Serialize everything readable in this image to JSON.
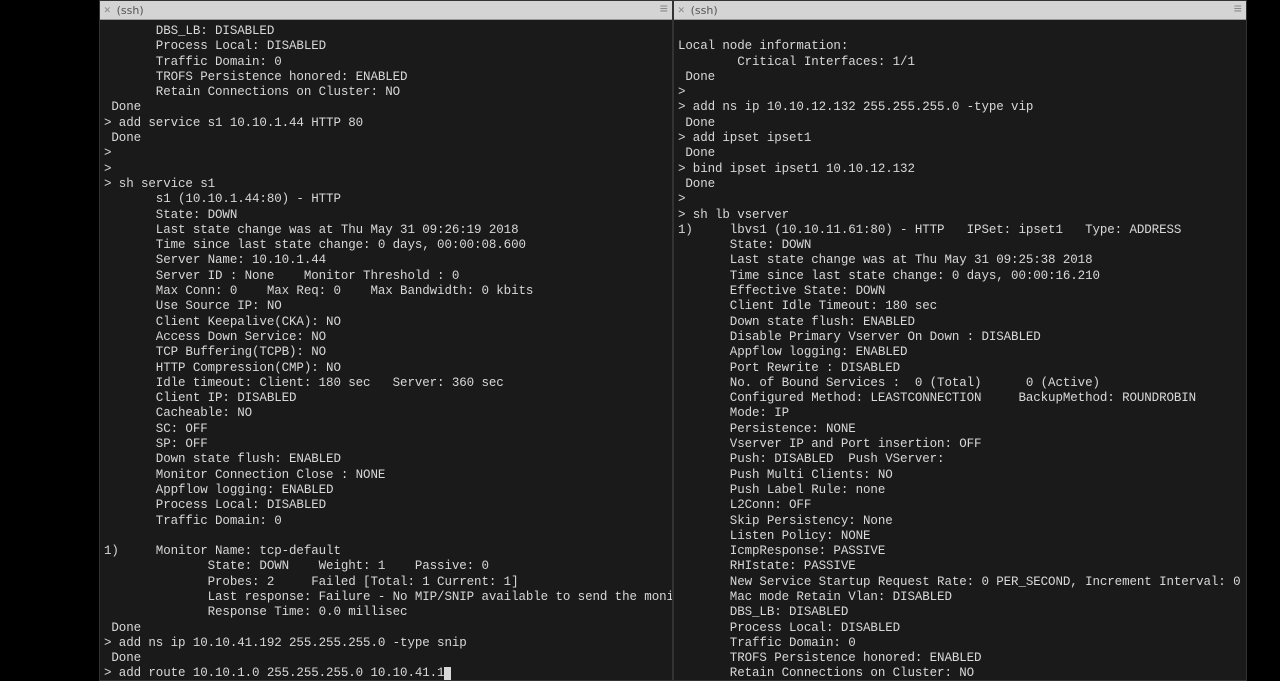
{
  "tabs": {
    "left": {
      "title": "(ssh)"
    },
    "right": {
      "title": "(ssh)"
    }
  },
  "left_terminal": [
    "       DBS_LB: DISABLED",
    "       Process Local: DISABLED",
    "       Traffic Domain: 0",
    "       TROFS Persistence honored: ENABLED",
    "       Retain Connections on Cluster: NO",
    " Done",
    "> add service s1 10.10.1.44 HTTP 80",
    " Done",
    ">",
    ">",
    "> sh service s1",
    "       s1 (10.10.1.44:80) - HTTP",
    "       State: DOWN",
    "       Last state change was at Thu May 31 09:26:19 2018",
    "       Time since last state change: 0 days, 00:00:08.600",
    "       Server Name: 10.10.1.44",
    "       Server ID : None    Monitor Threshold : 0",
    "       Max Conn: 0    Max Req: 0    Max Bandwidth: 0 kbits",
    "       Use Source IP: NO",
    "       Client Keepalive(CKA): NO",
    "       Access Down Service: NO",
    "       TCP Buffering(TCPB): NO",
    "       HTTP Compression(CMP): NO",
    "       Idle timeout: Client: 180 sec   Server: 360 sec",
    "       Client IP: DISABLED",
    "       Cacheable: NO",
    "       SC: OFF",
    "       SP: OFF",
    "       Down state flush: ENABLED",
    "       Monitor Connection Close : NONE",
    "       Appflow logging: ENABLED",
    "       Process Local: DISABLED",
    "       Traffic Domain: 0",
    "",
    "1)     Monitor Name: tcp-default",
    "              State: DOWN    Weight: 1    Passive: 0",
    "              Probes: 2     Failed [Total: 1 Current: 1]",
    "              Last response: Failure - No MIP/SNIP available to send the monitor probe.",
    "              Response Time: 0.0 millisec",
    " Done",
    "> add ns ip 10.10.41.192 255.255.255.0 -type snip",
    " Done",
    "> add route 10.10.1.0 255.255.255.0 10.10.41.1"
  ],
  "right_terminal": [
    "",
    "Local node information:",
    "        Critical Interfaces: 1/1",
    " Done",
    ">",
    "> add ns ip 10.10.12.132 255.255.255.0 -type vip",
    " Done",
    "> add ipset ipset1",
    " Done",
    "> bind ipset ipset1 10.10.12.132",
    " Done",
    ">",
    "> sh lb vserver",
    "1)     lbvs1 (10.10.11.61:80) - HTTP   IPSet: ipset1   Type: ADDRESS",
    "       State: DOWN",
    "       Last state change was at Thu May 31 09:25:38 2018",
    "       Time since last state change: 0 days, 00:00:16.210",
    "       Effective State: DOWN",
    "       Client Idle Timeout: 180 sec",
    "       Down state flush: ENABLED",
    "       Disable Primary Vserver On Down : DISABLED",
    "       Appflow logging: ENABLED",
    "       Port Rewrite : DISABLED",
    "       No. of Bound Services :  0 (Total)      0 (Active)",
    "       Configured Method: LEASTCONNECTION     BackupMethod: ROUNDROBIN",
    "       Mode: IP",
    "       Persistence: NONE",
    "       Vserver IP and Port insertion: OFF",
    "       Push: DISABLED  Push VServer:",
    "       Push Multi Clients: NO",
    "       Push Label Rule: none",
    "       L2Conn: OFF",
    "       Skip Persistency: None",
    "       Listen Policy: NONE",
    "       IcmpResponse: PASSIVE",
    "       RHIstate: PASSIVE",
    "       New Service Startup Request Rate: 0 PER_SECOND, Increment Interval: 0",
    "       Mac mode Retain Vlan: DISABLED",
    "       DBS_LB: DISABLED",
    "       Process Local: DISABLED",
    "       Traffic Domain: 0",
    "       TROFS Persistence honored: ENABLED",
    "       Retain Connections on Cluster: NO"
  ]
}
